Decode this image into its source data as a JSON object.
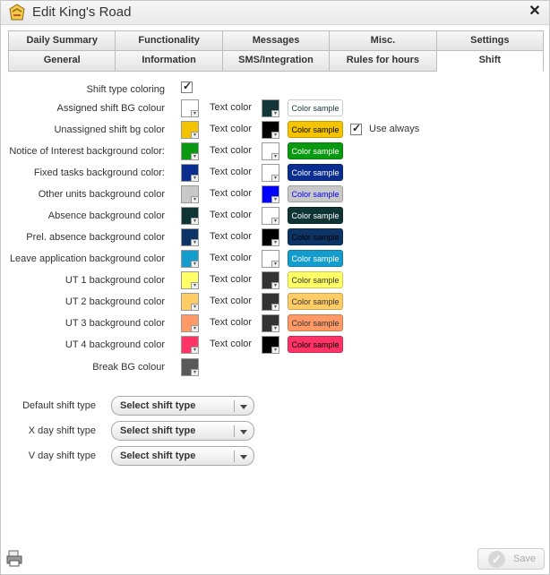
{
  "window": {
    "title": "Edit King's Road"
  },
  "tabs": {
    "row1": [
      "Daily Summary",
      "Functionality",
      "Messages",
      "Misc.",
      "Settings"
    ],
    "row2": [
      "General",
      "Information",
      "SMS/Integration",
      "Rules for hours",
      "Shift"
    ],
    "active": "Shift"
  },
  "shift_type_coloring": {
    "label": "Shift type coloring",
    "checked": true
  },
  "text_color_label": "Text color",
  "color_sample_text": "Color sample",
  "use_always": {
    "label": "Use always",
    "checked": true
  },
  "color_rows": [
    {
      "label": "Assigned shift BG colour",
      "bg": "#ffffff",
      "text_swatch": "#13363a",
      "sample_bg": "#ffffff",
      "sample_fg": "#13363a"
    },
    {
      "label": "Unassigned shift bg color",
      "bg": "#f5c400",
      "text_swatch": "#000000",
      "sample_bg": "#f5c400",
      "sample_fg": "#000000"
    },
    {
      "label": "Notice of Interest background color:",
      "bg": "#0a9a12",
      "text_swatch": "#ffffff",
      "sample_bg": "#0a9a12",
      "sample_fg": "#ffffff"
    },
    {
      "label": "Fixed tasks background color:",
      "bg": "#0a2e8f",
      "text_swatch": "#ffffff",
      "sample_bg": "#0a2e8f",
      "sample_fg": "#ffffff"
    },
    {
      "label": "Other units background color",
      "bg": "#c8c8c8",
      "text_swatch": "#0000ff",
      "sample_bg": "#c8c8c8",
      "sample_fg": "#0000ff"
    },
    {
      "label": "Absence background color",
      "bg": "#0e3434",
      "text_swatch": "#ffffff",
      "sample_bg": "#0e3434",
      "sample_fg": "#ffffff"
    },
    {
      "label": "Prel. absence background color",
      "bg": "#0c3466",
      "text_swatch": "#000000",
      "sample_bg": "#0c3466",
      "sample_fg": "#000000"
    },
    {
      "label": "Leave application background color",
      "bg": "#149ccc",
      "text_swatch": "#ffffff",
      "sample_bg": "#149ccc",
      "sample_fg": "#ffffff"
    },
    {
      "label": "UT 1 background color",
      "bg": "#ffff66",
      "text_swatch": "#333333",
      "sample_bg": "#ffff66",
      "sample_fg": "#333333"
    },
    {
      "label": "UT 2 background color",
      "bg": "#ffcc66",
      "text_swatch": "#333333",
      "sample_bg": "#ffcc66",
      "sample_fg": "#333333"
    },
    {
      "label": "UT 3 background color",
      "bg": "#ff9966",
      "text_swatch": "#333333",
      "sample_bg": "#ff9966",
      "sample_fg": "#333333"
    },
    {
      "label": "UT 4 background color",
      "bg": "#ff3366",
      "text_swatch": "#000000",
      "sample_bg": "#ff3366",
      "sample_fg": "#000000"
    }
  ],
  "break_bg": {
    "label": "Break BG colour",
    "bg": "#595959"
  },
  "shift_type_selects": [
    {
      "label": "Default shift type",
      "value": "Select shift type"
    },
    {
      "label": "X day shift type",
      "value": "Select shift type"
    },
    {
      "label": "V day shift type",
      "value": "Select shift type"
    }
  ],
  "footer": {
    "save_label": "Save"
  }
}
